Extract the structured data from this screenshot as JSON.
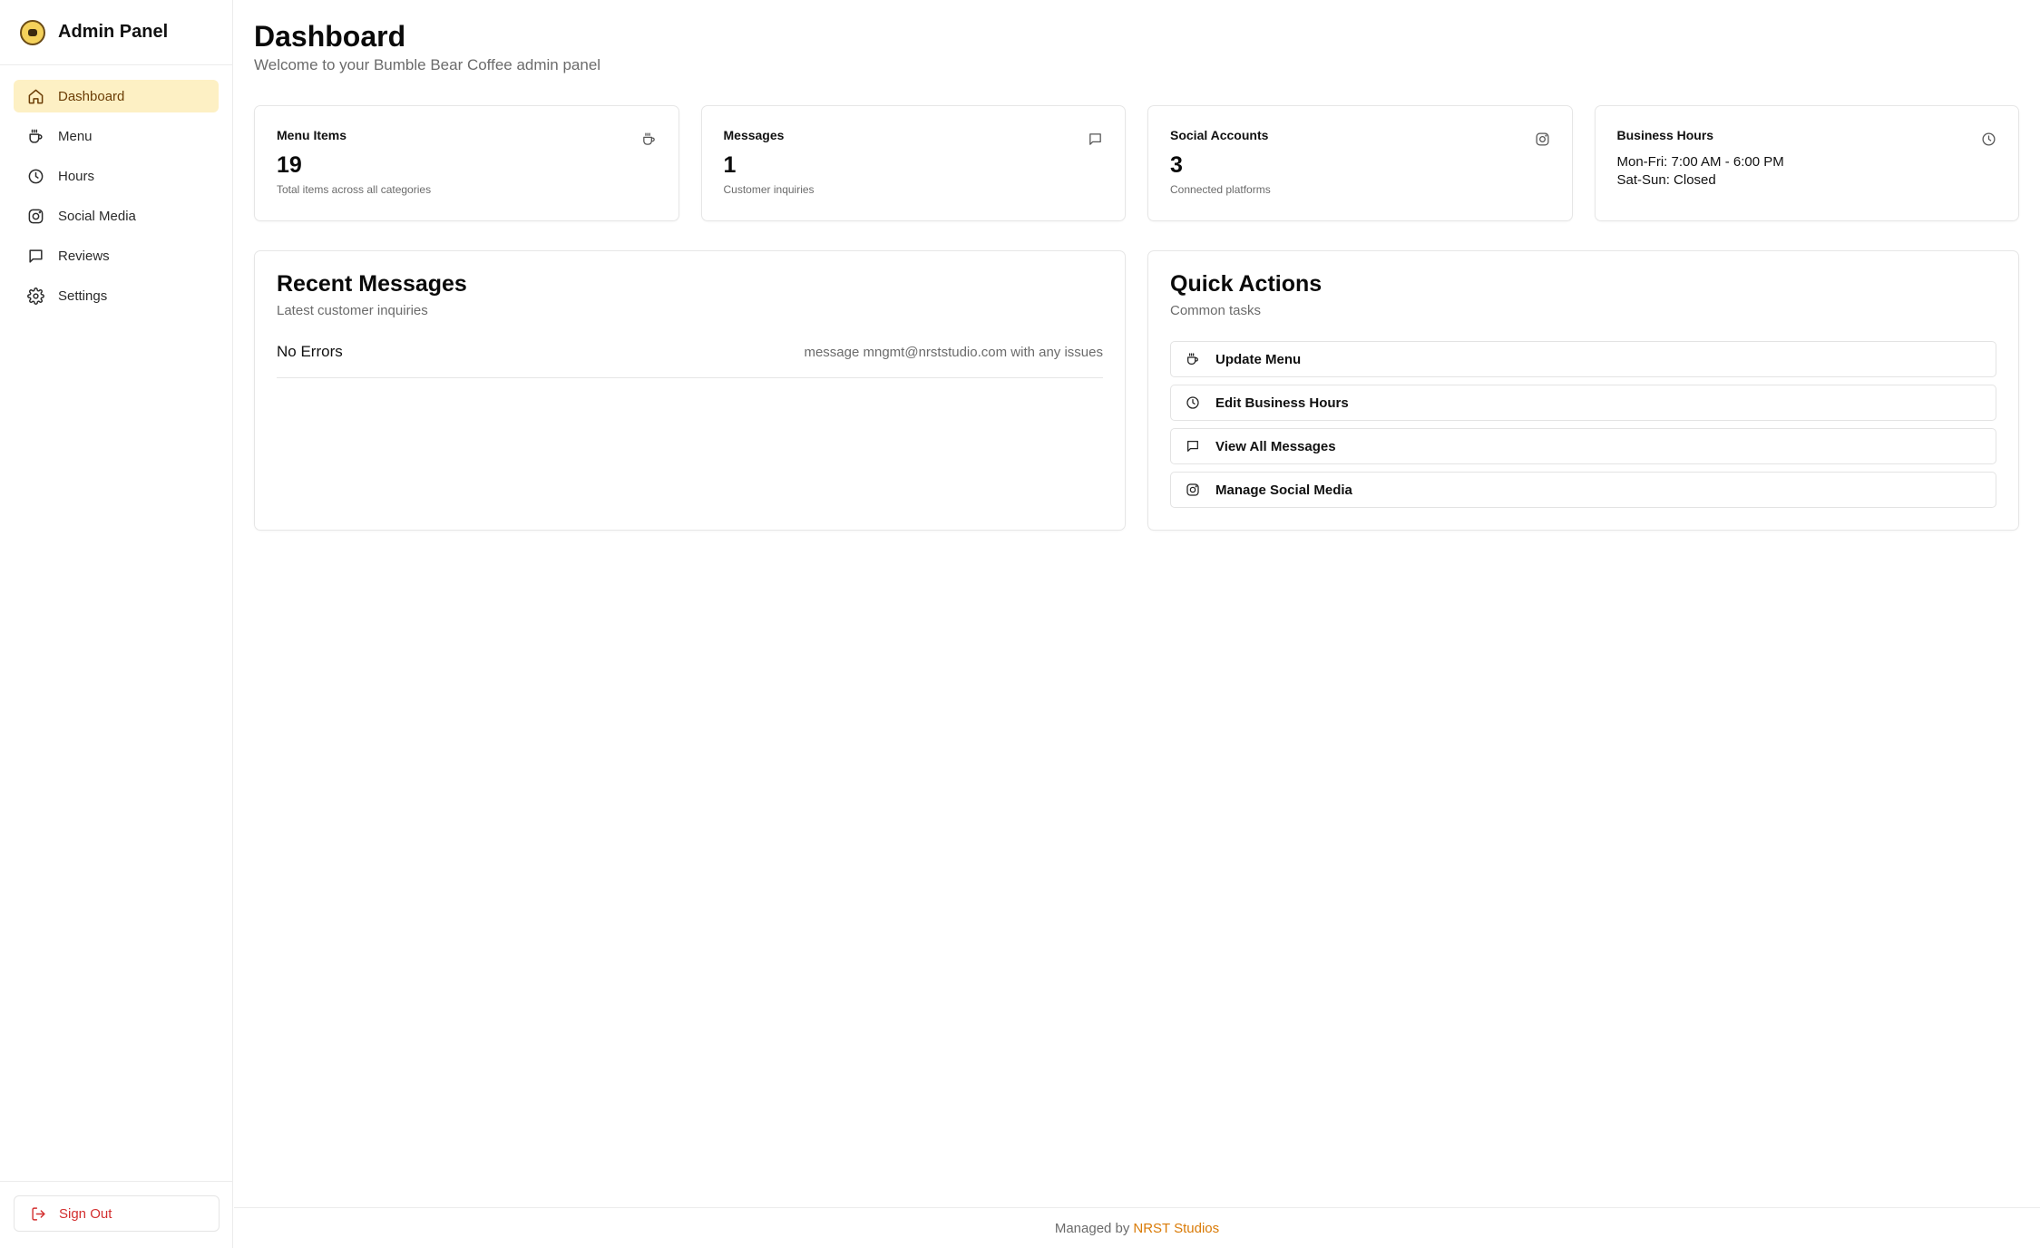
{
  "sidebar": {
    "brand_title": "Admin Panel",
    "logo_icon": "bear-logo-icon",
    "items": [
      {
        "label": "Dashboard",
        "icon": "home-icon",
        "active": true
      },
      {
        "label": "Menu",
        "icon": "coffee-icon",
        "active": false
      },
      {
        "label": "Hours",
        "icon": "clock-icon",
        "active": false
      },
      {
        "label": "Social Media",
        "icon": "instagram-icon",
        "active": false
      },
      {
        "label": "Reviews",
        "icon": "message-icon",
        "active": false
      },
      {
        "label": "Settings",
        "icon": "gear-icon",
        "active": false
      }
    ],
    "signout_label": "Sign Out",
    "signout_icon": "logout-icon"
  },
  "header": {
    "title": "Dashboard",
    "subtitle": "Welcome to your Bumble Bear Coffee admin panel"
  },
  "stats": [
    {
      "label": "Menu Items",
      "value": "19",
      "desc": "Total items across all categories",
      "icon": "coffee-icon"
    },
    {
      "label": "Messages",
      "value": "1",
      "desc": "Customer inquiries",
      "icon": "message-icon"
    },
    {
      "label": "Social Accounts",
      "value": "3",
      "desc": "Connected platforms",
      "icon": "instagram-icon"
    },
    {
      "label": "Business Hours",
      "lines": [
        "Mon-Fri: 7:00 AM - 6:00 PM",
        "Sat-Sun: Closed"
      ],
      "icon": "clock-icon"
    }
  ],
  "recent_messages": {
    "title": "Recent Messages",
    "subtitle": "Latest customer inquiries",
    "rows": [
      {
        "title": "No Errors",
        "note": "message mngmt@nrststudio.com with any issues"
      }
    ]
  },
  "quick_actions": {
    "title": "Quick Actions",
    "subtitle": "Common tasks",
    "items": [
      {
        "label": "Update Menu",
        "icon": "coffee-icon"
      },
      {
        "label": "Edit Business Hours",
        "icon": "clock-icon"
      },
      {
        "label": "View All Messages",
        "icon": "message-icon"
      },
      {
        "label": "Manage Social Media",
        "icon": "instagram-icon"
      }
    ]
  },
  "footer": {
    "prefix": "Managed by",
    "link": "NRST Studios"
  },
  "colors": {
    "accent": "#fdf0c4",
    "accent_text": "#6b3d05",
    "danger": "#d32f2f",
    "link": "#d97a06"
  }
}
